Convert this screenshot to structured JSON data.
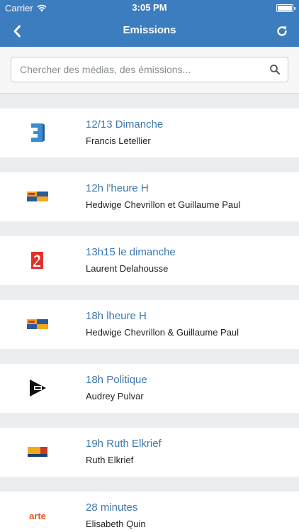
{
  "status": {
    "carrier": "Carrier",
    "time": "3:05 PM"
  },
  "nav": {
    "title": "Emissions"
  },
  "search": {
    "placeholder": "Chercher des médias, des émissions..."
  },
  "emissions": [
    {
      "title": "12/13 Dimanche",
      "host": "Francis Letellier",
      "logo": "france3-logo"
    },
    {
      "title": "12h l'heure H",
      "host": "Hedwige Chevrillon et Guillaume Paul",
      "logo": "bfm-business-logo"
    },
    {
      "title": "13h15 le dimanche",
      "host": "Laurent Delahousse",
      "logo": "france2-logo"
    },
    {
      "title": "18h lheure H",
      "host": "Hedwige Chevrillon & Guillaume Paul",
      "logo": "bfm-business-logo"
    },
    {
      "title": "18h Politique",
      "host": "Audrey Pulvar",
      "logo": "itele-logo"
    },
    {
      "title": "19h Ruth Elkrief",
      "host": "Ruth Elkrief",
      "logo": "bfmtv-logo"
    },
    {
      "title": "28 minutes",
      "host": "Elisabeth Quin",
      "logo": "arte-logo"
    }
  ],
  "logos": {
    "arte_text": "arte"
  },
  "colors": {
    "nav": "#3b7dbf",
    "title_link": "#3d77b0",
    "background": "#ebeef0"
  }
}
